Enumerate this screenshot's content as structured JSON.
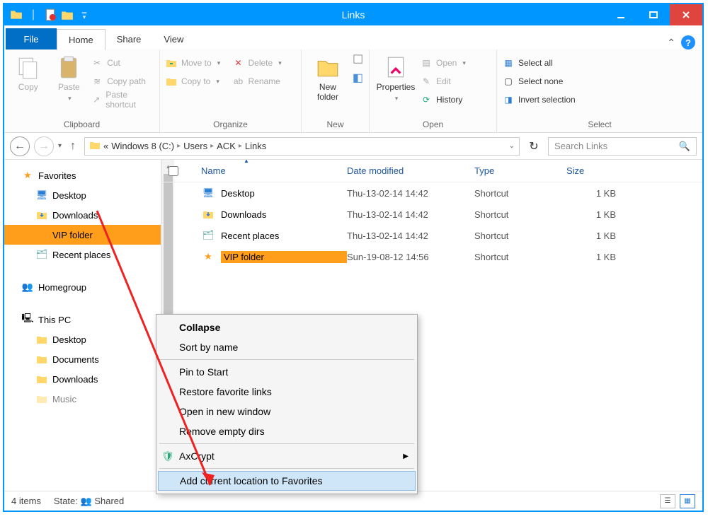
{
  "window": {
    "title": "Links"
  },
  "tabs": {
    "file": "File",
    "home": "Home",
    "share": "Share",
    "view": "View"
  },
  "ribbon": {
    "clipboard": {
      "label": "Clipboard",
      "copy": "Copy",
      "paste": "Paste",
      "cut": "Cut",
      "copypath": "Copy path",
      "pasteshortcut": "Paste shortcut"
    },
    "organize": {
      "label": "Organize",
      "moveto": "Move to",
      "copyto": "Copy to",
      "delete": "Delete",
      "rename": "Rename"
    },
    "new": {
      "label": "New",
      "newfolder": "New\nfolder"
    },
    "open": {
      "label": "Open",
      "properties": "Properties",
      "open": "Open",
      "edit": "Edit",
      "history": "History"
    },
    "select": {
      "label": "Select",
      "all": "Select all",
      "none": "Select none",
      "invert": "Invert selection"
    }
  },
  "addr": {
    "prefix": "«",
    "drive": "Windows 8 (C:)",
    "users": "Users",
    "user": "ACK",
    "folder": "Links",
    "search_placeholder": "Search Links"
  },
  "sidebar": {
    "favorites": "Favorites",
    "items": [
      "Desktop",
      "Downloads",
      "VIP folder",
      "Recent places"
    ],
    "homegroup": "Homegroup",
    "thispc": "This PC",
    "pcitems": [
      "Desktop",
      "Documents",
      "Downloads",
      "Music"
    ]
  },
  "columns": {
    "name": "Name",
    "date": "Date modified",
    "type": "Type",
    "size": "Size"
  },
  "rows": [
    {
      "name": "Desktop",
      "date": "Thu-13-02-14 14:42",
      "type": "Shortcut",
      "size": "1 KB",
      "icon": "desktop"
    },
    {
      "name": "Downloads",
      "date": "Thu-13-02-14 14:42",
      "type": "Shortcut",
      "size": "1 KB",
      "icon": "folder"
    },
    {
      "name": "Recent places",
      "date": "Thu-13-02-14 14:42",
      "type": "Shortcut",
      "size": "1 KB",
      "icon": "recent"
    },
    {
      "name": "VIP folder",
      "date": "Sun-19-08-12 14:56",
      "type": "Shortcut",
      "size": "1 KB",
      "icon": "star",
      "selected": true
    }
  ],
  "context": {
    "collapse": "Collapse",
    "sort": "Sort by name",
    "pin": "Pin to Start",
    "restore": "Restore favorite links",
    "opennew": "Open in new window",
    "removeempty": "Remove empty dirs",
    "axcrypt": "AxCrypt",
    "addfav": "Add current location to Favorites"
  },
  "status": {
    "items": "4 items",
    "state_label": "State:",
    "shared": "Shared"
  }
}
